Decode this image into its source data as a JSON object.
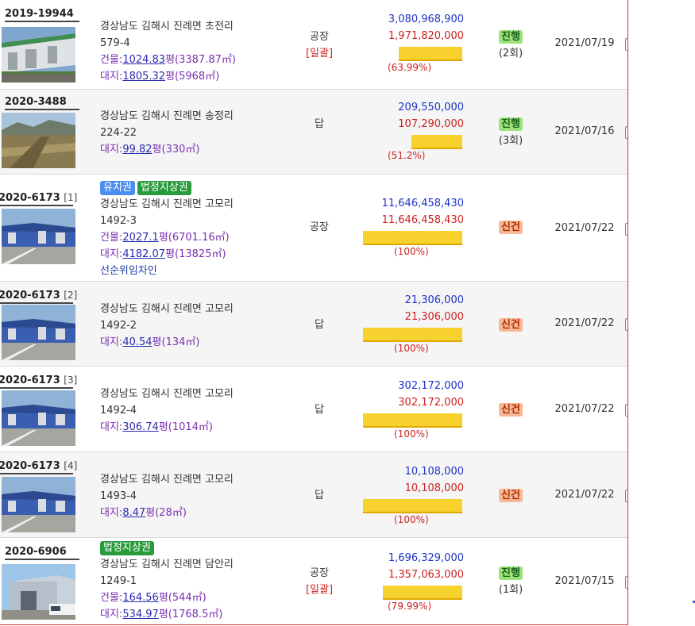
{
  "rows": [
    {
      "case": "2019-19944",
      "sub": "",
      "badges": [],
      "addr": "경상남도 김해시 진례면 초전리",
      "lot": "579-4",
      "bldg_label": "건물:",
      "bldg_pyeong": "1024.83",
      "bldg_unit": "평",
      "bldg_m2": "(3387.87㎡)",
      "land_label": "대지:",
      "land_pyeong": "1805.32",
      "land_unit": "평",
      "land_m2": "(5968㎡)",
      "note": "",
      "usage": "공장",
      "usage_note": "[일괄]",
      "appraisal": "3,080,968,900",
      "minimum": "1,971,820,000",
      "ratio_text": "(63.99%)",
      "ratio": 0.64,
      "status": "진행",
      "status_kind": "jin",
      "round": "(2회)",
      "date": "2021/07/19",
      "thumb": "building-photo-icon"
    },
    {
      "case": "2020-3488",
      "sub": "",
      "badges": [],
      "addr": "경상남도 김해시 진례면 송정리",
      "lot": "224-22",
      "bldg_label": "",
      "bldg_pyeong": "",
      "bldg_unit": "",
      "bldg_m2": "",
      "land_label": "대지:",
      "land_pyeong": "99.82",
      "land_unit": "평",
      "land_m2": "(330㎡)",
      "note": "",
      "usage": "답",
      "usage_note": "",
      "appraisal": "209,550,000",
      "minimum": "107,290,000",
      "ratio_text": "(51.2%)",
      "ratio": 0.512,
      "status": "진행",
      "status_kind": "jin",
      "round": "(3회)",
      "date": "2021/07/16",
      "thumb": "field-photo-icon"
    },
    {
      "case": "2020-6173",
      "sub": "[1]",
      "badges": [
        {
          "text": "유치권",
          "kind": "blue"
        },
        {
          "text": "법정지상권",
          "kind": "green"
        }
      ],
      "addr": "경상남도 김해시 진례면 고모리",
      "lot": "1492-3",
      "bldg_label": "건물:",
      "bldg_pyeong": "2027.1",
      "bldg_unit": "평",
      "bldg_m2": "(6701.16㎡)",
      "land_label": "대지:",
      "land_pyeong": "4182.07",
      "land_unit": "평",
      "land_m2": "(13825㎡)",
      "note": "선순위임차인",
      "usage": "공장",
      "usage_note": "",
      "appraisal": "11,646,458,430",
      "minimum": "11,646,458,430",
      "ratio_text": "(100%)",
      "ratio": 1.0,
      "status": "신건",
      "status_kind": "sin",
      "round": "",
      "date": "2021/07/22",
      "thumb": "factory-photo-icon"
    },
    {
      "case": "2020-6173",
      "sub": "[2]",
      "badges": [],
      "addr": "경상남도 김해시 진례면 고모리",
      "lot": "1492-2",
      "bldg_label": "",
      "bldg_pyeong": "",
      "bldg_unit": "",
      "bldg_m2": "",
      "land_label": "대지:",
      "land_pyeong": "40.54",
      "land_unit": "평",
      "land_m2": "(134㎡)",
      "note": "",
      "usage": "답",
      "usage_note": "",
      "appraisal": "21,306,000",
      "minimum": "21,306,000",
      "ratio_text": "(100%)",
      "ratio": 1.0,
      "status": "신건",
      "status_kind": "sin",
      "round": "",
      "date": "2021/07/22",
      "thumb": "factory-photo-icon"
    },
    {
      "case": "2020-6173",
      "sub": "[3]",
      "badges": [],
      "addr": "경상남도 김해시 진례면 고모리",
      "lot": "1492-4",
      "bldg_label": "",
      "bldg_pyeong": "",
      "bldg_unit": "",
      "bldg_m2": "",
      "land_label": "대지:",
      "land_pyeong": "306.74",
      "land_unit": "평",
      "land_m2": "(1014㎡)",
      "note": "",
      "usage": "답",
      "usage_note": "",
      "appraisal": "302,172,000",
      "minimum": "302,172,000",
      "ratio_text": "(100%)",
      "ratio": 1.0,
      "status": "신건",
      "status_kind": "sin",
      "round": "",
      "date": "2021/07/22",
      "thumb": "factory-photo-icon"
    },
    {
      "case": "2020-6173",
      "sub": "[4]",
      "badges": [],
      "addr": "경상남도 김해시 진례면 고모리",
      "lot": "1493-4",
      "bldg_label": "",
      "bldg_pyeong": "",
      "bldg_unit": "",
      "bldg_m2": "",
      "land_label": "대지:",
      "land_pyeong": "8.47",
      "land_unit": "평",
      "land_m2": "(28㎡)",
      "note": "",
      "usage": "답",
      "usage_note": "",
      "appraisal": "10,108,000",
      "minimum": "10,108,000",
      "ratio_text": "(100%)",
      "ratio": 1.0,
      "status": "신건",
      "status_kind": "sin",
      "round": "",
      "date": "2021/07/22",
      "thumb": "factory-photo-icon"
    },
    {
      "case": "2020-6906",
      "sub": "",
      "badges": [
        {
          "text": "법정지상권",
          "kind": "green"
        }
      ],
      "addr": "경상남도 김해시 진례면 담안리",
      "lot": "1249-1",
      "bldg_label": "건물:",
      "bldg_pyeong": "164.56",
      "bldg_unit": "평",
      "bldg_m2": "(544㎡)",
      "land_label": "대지:",
      "land_pyeong": "534.97",
      "land_unit": "평",
      "land_m2": "(1768.5㎡)",
      "note": "",
      "usage": "공장",
      "usage_note": "[일괄]",
      "appraisal": "1,696,329,000",
      "minimum": "1,357,063,000",
      "ratio_text": "(79.99%)",
      "ratio": 0.8,
      "status": "진행",
      "status_kind": "jin",
      "round": "(1회)",
      "date": "2021/07/15",
      "thumb": "warehouse-photo-icon"
    }
  ],
  "colors": {
    "appraisal": "#1f32c8",
    "minimum": "#cc2222",
    "bar": "#f7d22e",
    "status_progress": "#9be37a",
    "status_new": "#f6b896",
    "frame_border": "#cc3333"
  }
}
